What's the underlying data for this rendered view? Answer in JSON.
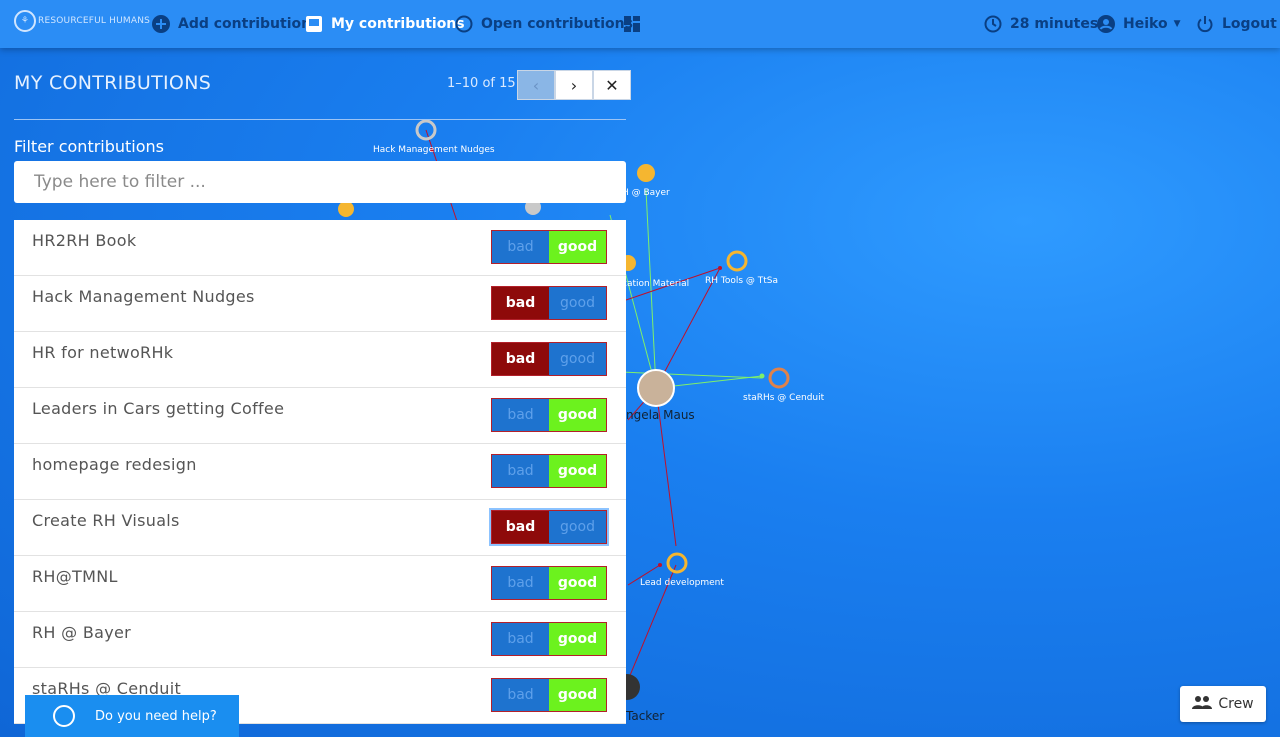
{
  "app": {
    "name": "RESOURCEFUL HUMANS"
  },
  "nav": {
    "add_contribution": "Add contribution",
    "my_contributions": "My contributions",
    "open_contributions": "Open contributions",
    "time": "28 minutes",
    "user": "Heiko",
    "logout": "Logout"
  },
  "panel": {
    "title": "MY CONTRIBUTIONS",
    "pager": "1–10 of 15",
    "filter_label": "Filter contributions",
    "filter_placeholder": "Type here to filter ..."
  },
  "contributions": [
    {
      "title": "HR2RH Book",
      "selected": "good"
    },
    {
      "title": "Hack Management Nudges",
      "selected": "bad"
    },
    {
      "title": "HR for netwoRHk",
      "selected": "bad"
    },
    {
      "title": "Leaders in Cars getting Coffee",
      "selected": "good"
    },
    {
      "title": "homepage redesign",
      "selected": "good"
    },
    {
      "title": "Create RH Visuals",
      "selected": "bad"
    },
    {
      "title": "RH@TMNL",
      "selected": "good"
    },
    {
      "title": "RH @ Bayer",
      "selected": "good"
    },
    {
      "title": "staRHs @ Cenduit",
      "selected": "good"
    }
  ],
  "toggle": {
    "bad": "bad",
    "good": "good"
  },
  "graph": {
    "nodes": {
      "hack": "Hack Management Nudges",
      "bayer": "H @ Bayer",
      "material": "cation Material",
      "tools": "RH Tools @ TtSa",
      "starhs": "staRHs @ Cenduit",
      "lead": "Lead development",
      "person1": "ngela Maus",
      "person2": "Tacker"
    }
  },
  "help": {
    "label": "Do you need help?"
  },
  "crew": {
    "label": "Crew"
  }
}
